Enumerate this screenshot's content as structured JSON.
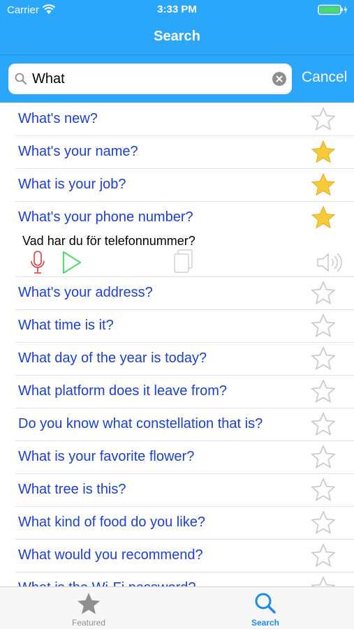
{
  "status": {
    "carrier": "Carrier",
    "time": "3:33 PM"
  },
  "nav": {
    "title": "Search"
  },
  "search": {
    "value": "What",
    "cancel_label": "Cancel"
  },
  "rows": [
    {
      "text": "What's new?",
      "starred": false
    },
    {
      "text": "What's your name?",
      "starred": true
    },
    {
      "text": "What is your job?",
      "starred": true
    },
    {
      "text": "What's your phone number?",
      "starred": true,
      "translation": "Vad har du för telefonnummer?"
    },
    {
      "text": "What's your address?",
      "starred": false
    },
    {
      "text": "What time is it?",
      "starred": false
    },
    {
      "text": "What day of the year is today?",
      "starred": false
    },
    {
      "text": "What platform does it leave from?",
      "starred": false
    },
    {
      "text": "Do you know what constellation that is?",
      "starred": false
    },
    {
      "text": "What is your favorite flower?",
      "starred": false
    },
    {
      "text": "What tree is this?",
      "starred": false
    },
    {
      "text": "What kind of food do you like?",
      "starred": false
    },
    {
      "text": "What would you recommend?",
      "starred": false
    },
    {
      "text": "What is the Wi-Fi password?",
      "starred": false
    }
  ],
  "actions": {
    "icons": [
      "microphone-icon",
      "play-icon",
      "copy-icon",
      "speaker-icon"
    ]
  },
  "tabs": [
    {
      "label": "Featured",
      "icon": "star-icon",
      "active": false
    },
    {
      "label": "Search",
      "icon": "search-icon",
      "active": true
    }
  ],
  "colors": {
    "bar_blue": "#2aa6fb",
    "row_text": "#1c3fd6",
    "star_filled": "#f8c938",
    "star_empty": "#c8c8c8",
    "mic_red": "#e5383b",
    "play_green": "#3ddc55",
    "tab_active": "#1a8cf0",
    "tab_inactive": "#8e8e93"
  }
}
